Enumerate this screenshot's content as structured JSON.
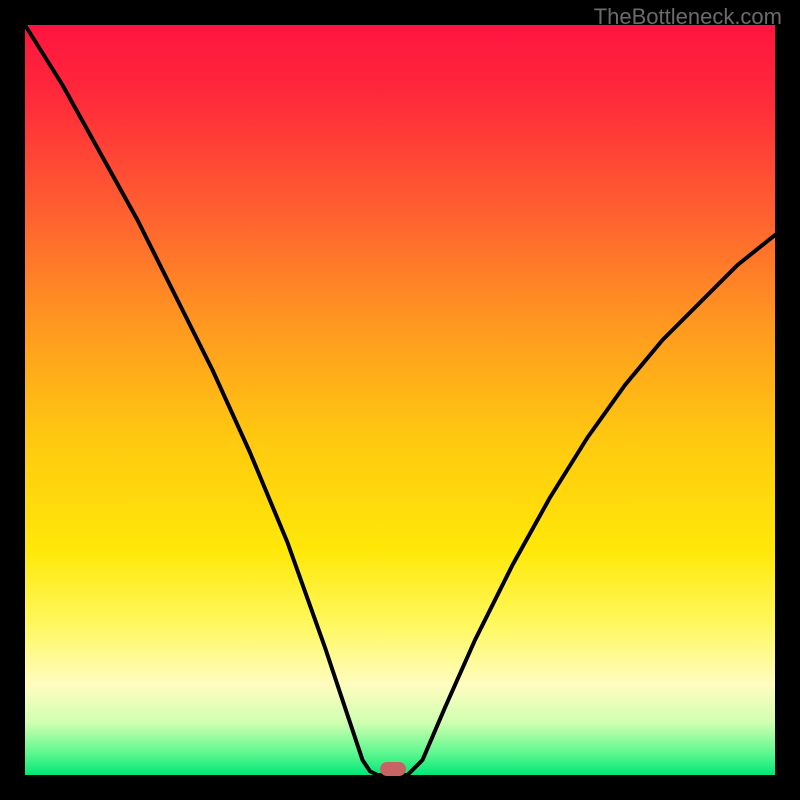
{
  "watermark": "TheBottleneck.com",
  "chart_data": {
    "type": "line",
    "title": "",
    "xlabel": "",
    "ylabel": "",
    "xlim": [
      0,
      100
    ],
    "ylim": [
      0,
      100
    ],
    "background_gradient": {
      "stops": [
        {
          "offset": 0.0,
          "color": "#ff1440"
        },
        {
          "offset": 0.1,
          "color": "#ff2b3a"
        },
        {
          "offset": 0.25,
          "color": "#ff6030"
        },
        {
          "offset": 0.4,
          "color": "#ff9820"
        },
        {
          "offset": 0.55,
          "color": "#ffc810"
        },
        {
          "offset": 0.7,
          "color": "#ffe808"
        },
        {
          "offset": 0.8,
          "color": "#fff860"
        },
        {
          "offset": 0.88,
          "color": "#fffcc0"
        },
        {
          "offset": 0.93,
          "color": "#d0ffb0"
        },
        {
          "offset": 0.97,
          "color": "#60f890"
        },
        {
          "offset": 1.0,
          "color": "#00e878"
        }
      ]
    },
    "series": [
      {
        "name": "left-curve",
        "x": [
          0,
          5,
          10,
          15,
          20,
          25,
          30,
          35,
          40,
          43,
          45,
          46,
          47
        ],
        "y": [
          100,
          92,
          83,
          74,
          64,
          54,
          43,
          31,
          17,
          8,
          2,
          0.5,
          0
        ]
      },
      {
        "name": "flat-bottom",
        "x": [
          47,
          51
        ],
        "y": [
          0,
          0
        ]
      },
      {
        "name": "right-curve",
        "x": [
          51,
          53,
          56,
          60,
          65,
          70,
          75,
          80,
          85,
          90,
          95,
          100
        ],
        "y": [
          0,
          2,
          9,
          18,
          28,
          37,
          45,
          52,
          58,
          63,
          68,
          72
        ]
      }
    ],
    "marker": {
      "x": 49,
      "y": 0.8,
      "color": "#c96262"
    }
  }
}
